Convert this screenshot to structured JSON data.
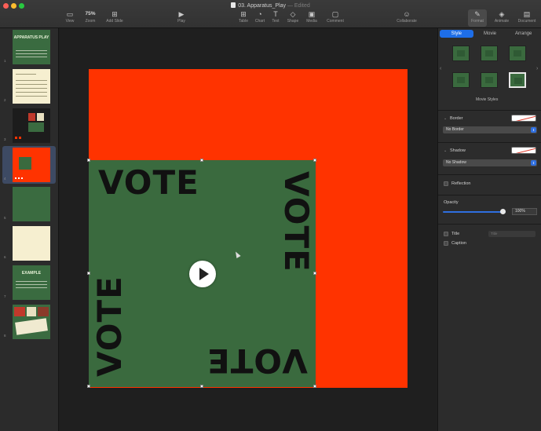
{
  "window": {
    "title": "03. Apparatus_Play",
    "status": "— Edited"
  },
  "toolbar": {
    "view_label": "View",
    "zoom_value": "75%",
    "zoom_label": "Zoom",
    "add_slide_label": "Add Slide",
    "play_label": "Play",
    "table_label": "Table",
    "chart_label": "Chart",
    "text_label": "Text",
    "shape_label": "Shape",
    "media_label": "Media",
    "comment_label": "Comment",
    "collaborate_label": "Collaborate",
    "format_label": "Format",
    "animate_label": "Animate",
    "document_label": "Document"
  },
  "navigator": {
    "slides": [
      {
        "num": "1",
        "style": "green",
        "title": "APPARATUS PLAY"
      },
      {
        "num": "2",
        "style": "cream",
        "title": ""
      },
      {
        "num": "3",
        "style": "dark",
        "title": ""
      },
      {
        "num": "4",
        "style": "red",
        "title": "",
        "selected": true
      },
      {
        "num": "5",
        "style": "green",
        "title": ""
      },
      {
        "num": "6",
        "style": "cream",
        "title": ""
      },
      {
        "num": "7",
        "style": "green",
        "title": "EXAMPLE"
      },
      {
        "num": "8",
        "style": "green",
        "title": ""
      }
    ]
  },
  "slide": {
    "background_color": "#ff3300",
    "movie_color": "#3a6a3e",
    "vote_words": [
      "VOTE",
      "VOTE",
      "VOTE",
      "VOTE"
    ]
  },
  "inspector": {
    "tabs": [
      "Style",
      "Movie",
      "Arrange"
    ],
    "active_tab": "Style",
    "movie_styles_label": "Movie Styles",
    "border_label": "Border",
    "border_value": "No Border",
    "shadow_label": "Shadow",
    "shadow_value": "No Shadow",
    "reflection_label": "Reflection",
    "opacity_label": "Opacity",
    "opacity_value": "100%",
    "title_label": "Title",
    "caption_label": "Caption",
    "title_popup_value": "Title"
  },
  "colors": {
    "accent": "#1e6ee8",
    "slide_red": "#ff3300",
    "movie_green": "#3a6a3e"
  }
}
